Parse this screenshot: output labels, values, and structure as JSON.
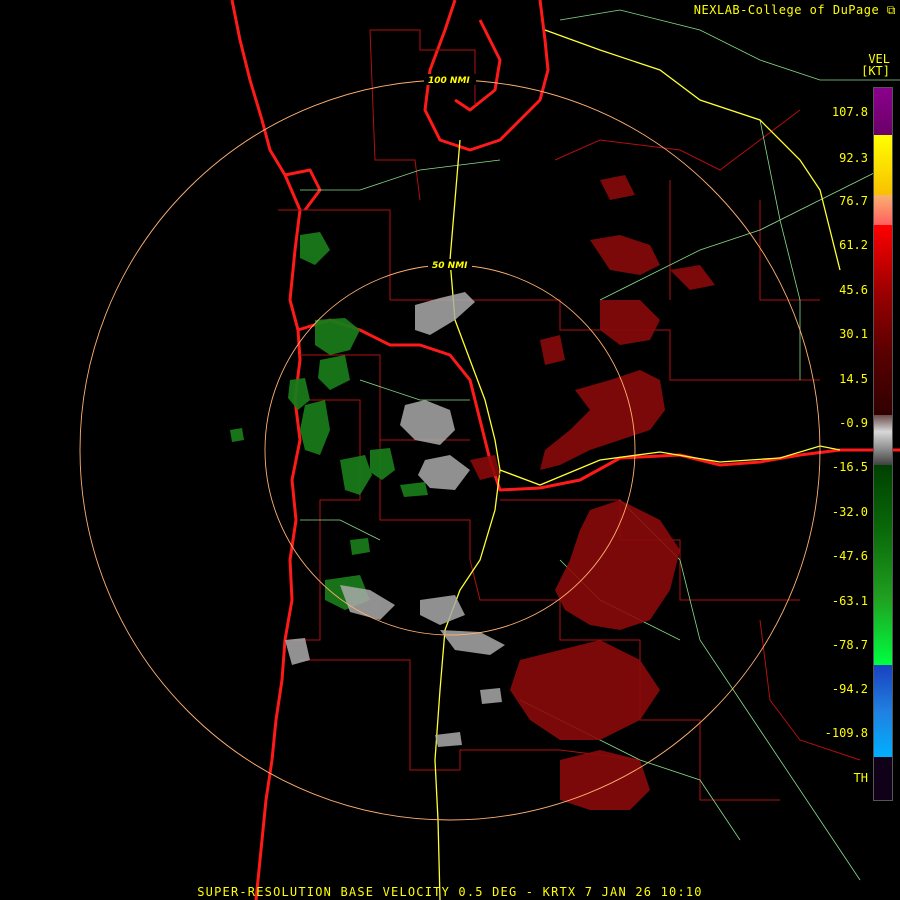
{
  "credit": "NEXLAB-College of DuPage",
  "credit_icon": "external-link-icon",
  "legend": {
    "product": "VEL",
    "unit": "[KT]",
    "labels": [
      "107.8",
      "92.3",
      "76.7",
      "61.2",
      "45.6",
      "30.1",
      "14.5",
      "-0.9",
      "-16.5",
      "-32.0",
      "-47.6",
      "-63.1",
      "-78.7",
      "-94.2",
      "-109.8",
      "TH"
    ]
  },
  "rings": [
    {
      "label": "100 NMI"
    },
    {
      "label": "50 NMI"
    }
  ],
  "footer": "SUPER-RESOLUTION BASE VELOCITY 0.5 DEG - KRTX 7 JAN 26 10:10",
  "colors": {
    "state_border": "#ff1a1a",
    "county_line": "#b01010",
    "highway": "#ffff33",
    "road": "#88dd88",
    "range_ring": "#ffb070",
    "inbound": "#1a7a1a",
    "outbound": "#8a0a0a",
    "near_zero": "#aaaaaa"
  }
}
